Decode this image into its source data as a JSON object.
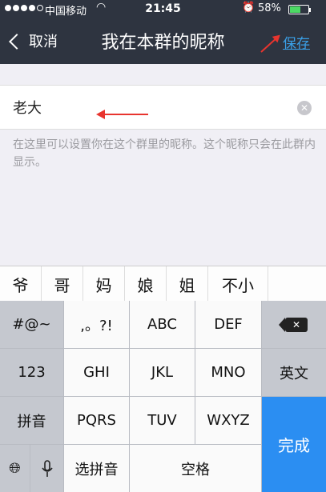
{
  "status": {
    "carrier": "中国移动",
    "time": "21:45",
    "battery": "58%",
    "battery_level": 0.58
  },
  "nav": {
    "back_label": "取消",
    "title": "我在本群的昵称",
    "save_label": "保存"
  },
  "field": {
    "value": "老大"
  },
  "hint": "在这里可以设置你在这个群里的昵称。这个昵称只会在此群内显示。",
  "candidates": [
    "爷",
    "哥",
    "妈",
    "娘",
    "姐",
    "不小"
  ],
  "keyboard": {
    "symbols": "#@~",
    "punct": ",。?!",
    "abc": "ABC",
    "def": "DEF",
    "num": "123",
    "ghi": "GHI",
    "jkl": "JKL",
    "mno": "MNO",
    "english": "英文",
    "pinyin": "拼音",
    "pqrs": "PQRS",
    "tuv": "TUV",
    "wxyz": "WXYZ",
    "done": "完成",
    "select_pinyin": "选拼音",
    "space": "空格"
  },
  "colors": {
    "topbar": "#2e3440",
    "accent": "#3aa0e8",
    "done_key": "#2b8ef2",
    "annotation_arrow": "#e8342e"
  }
}
